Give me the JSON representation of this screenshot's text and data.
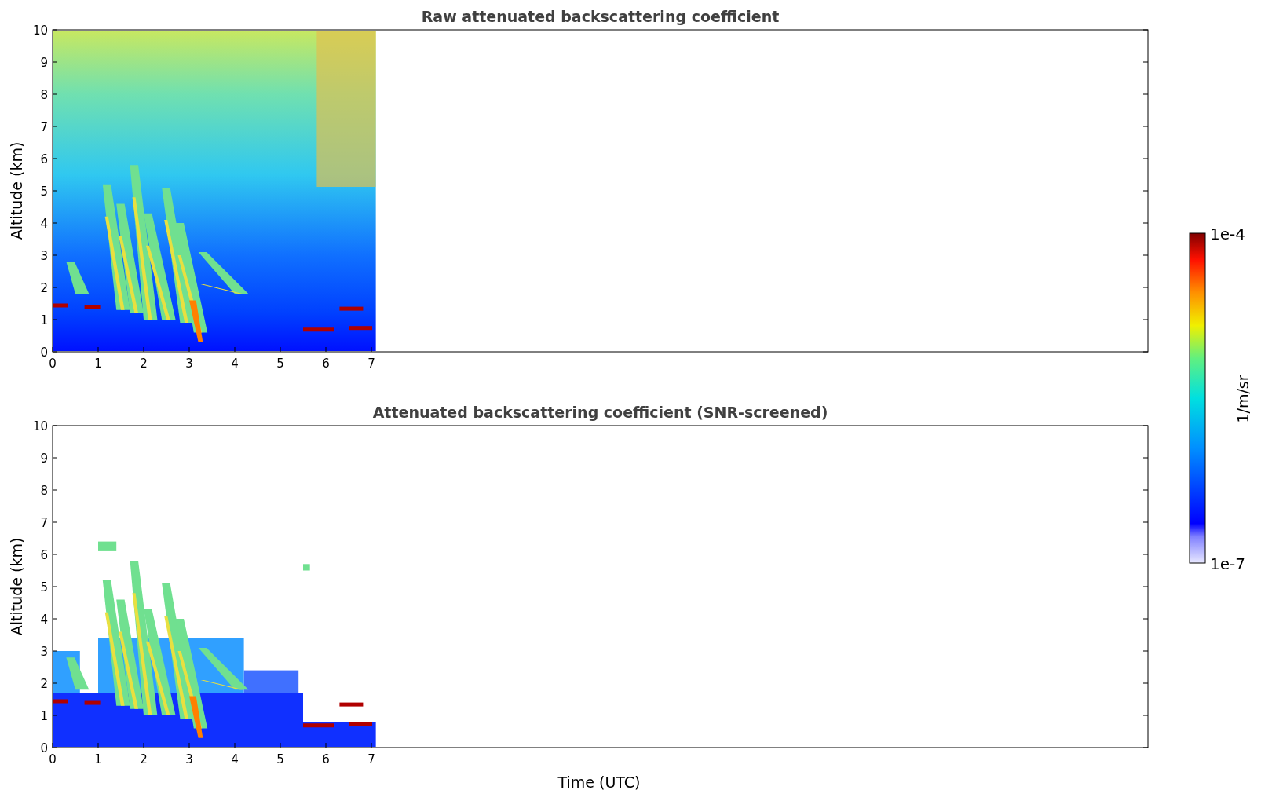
{
  "panels": [
    {
      "kind": "raw",
      "title": "Raw attenuated backscattering coefficient",
      "ylabel": "Altitude (km)",
      "yticks": [
        "10",
        "9",
        "8",
        "7",
        "6",
        "5",
        "4",
        "3",
        "2",
        "1",
        "0"
      ],
      "xticks": [
        "0",
        "1",
        "2",
        "3",
        "4",
        "5",
        "6",
        "7"
      ]
    },
    {
      "kind": "screened",
      "title": "Attenuated backscattering coefficient (SNR-screened)",
      "ylabel": "Altitude (km)",
      "yticks": [
        "10",
        "9",
        "8",
        "7",
        "6",
        "5",
        "4",
        "3",
        "2",
        "1",
        "0"
      ],
      "xticks": [
        "0",
        "1",
        "2",
        "3",
        "4",
        "5",
        "6",
        "7"
      ]
    }
  ],
  "xlabel": "Time (UTC)",
  "colorbar": {
    "max_label": "1e-4",
    "min_label": "1e-7",
    "label": "1/m/sr"
  }
}
